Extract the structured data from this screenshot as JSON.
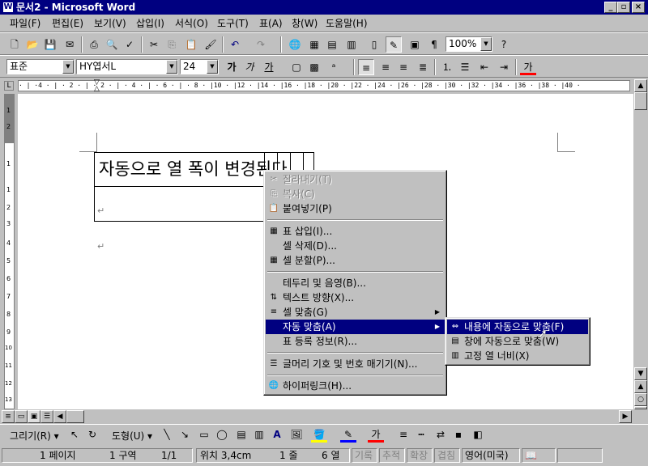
{
  "window": {
    "title": "문서2 - Microsoft Word",
    "icon_glyph": "W",
    "minimize": "_",
    "restore": "▫",
    "close": "×"
  },
  "menu": [
    "파일(F)",
    "편집(E)",
    "보기(V)",
    "삽입(I)",
    "서식(O)",
    "도구(T)",
    "표(A)",
    "창(W)",
    "도움말(H)"
  ],
  "toolbar": {
    "zoom": "100%"
  },
  "format": {
    "style": "표준",
    "font": "HY엽서L",
    "size": "24"
  },
  "ruler": {
    "text": "· | ·4 · | · 2 · | · 2 · | · 4 · | · 6 · | · 8 · |10 · |12 · |14 · |16 · |18 · |20 · |22 · |24 · |26 · |28 · |30 · |32 · |34 · |36 · |38 · |40 ·"
  },
  "vruler": {
    "marks": [
      "1",
      "2",
      "1",
      "1",
      "2",
      "3",
      "4",
      "5",
      "6",
      "7",
      "8",
      "9",
      "10",
      "11",
      "12",
      "13"
    ]
  },
  "document": {
    "cell_text": "자동으로 열 폭이 변경된다.",
    "para_mark": "↵"
  },
  "context_menu": {
    "items": [
      {
        "label": "잘라내기(T)",
        "icon": "✂",
        "disabled": true
      },
      {
        "label": "복사(C)",
        "icon": "⎘",
        "disabled": true
      },
      {
        "label": "붙여넣기(P)",
        "icon": "📋",
        "disabled": false
      },
      {
        "label": "표 삽입(I)...",
        "icon": "▦",
        "disabled": false
      },
      {
        "label": "셀 삭제(D)...",
        "icon": "",
        "disabled": false
      },
      {
        "label": "셀 분할(P)...",
        "icon": "▦",
        "disabled": false
      },
      {
        "label": "테두리 및 음영(B)...",
        "icon": "",
        "disabled": false
      },
      {
        "label": "텍스트 방향(X)...",
        "icon": "⇅",
        "disabled": false
      },
      {
        "label": "셀 맞춤(G)",
        "icon": "≡",
        "disabled": false,
        "submenu": true
      },
      {
        "label": "자동 맞춤(A)",
        "icon": "",
        "disabled": false,
        "submenu": true,
        "highlighted": true
      },
      {
        "label": "표 등록 정보(R)...",
        "icon": "",
        "disabled": false
      },
      {
        "label": "글머리 기호 및 번호 매기기(N)...",
        "icon": "☰",
        "disabled": false
      },
      {
        "label": "하이퍼링크(H)...",
        "icon": "🌐",
        "disabled": false
      }
    ]
  },
  "submenu": {
    "items": [
      {
        "label": "내용에 자동으로 맞춤(F)",
        "highlighted": true
      },
      {
        "label": "창에 자동으로 맞춤(W)",
        "highlighted": false
      },
      {
        "label": "고정 열 너비(X)",
        "highlighted": false
      }
    ]
  },
  "drawbar": {
    "draw": "그리기(R) ▾",
    "autoshapes": "도형(U) ▾"
  },
  "status": {
    "page": "1 페이지",
    "section": "1 구역",
    "pages": "1/1",
    "position": "위치 3,4cm",
    "line": "1 줄",
    "column": "6 열",
    "rec": "기록",
    "trk": "추적",
    "ext": "확장",
    "ovr": "겹침",
    "language": "영어(미국)"
  }
}
